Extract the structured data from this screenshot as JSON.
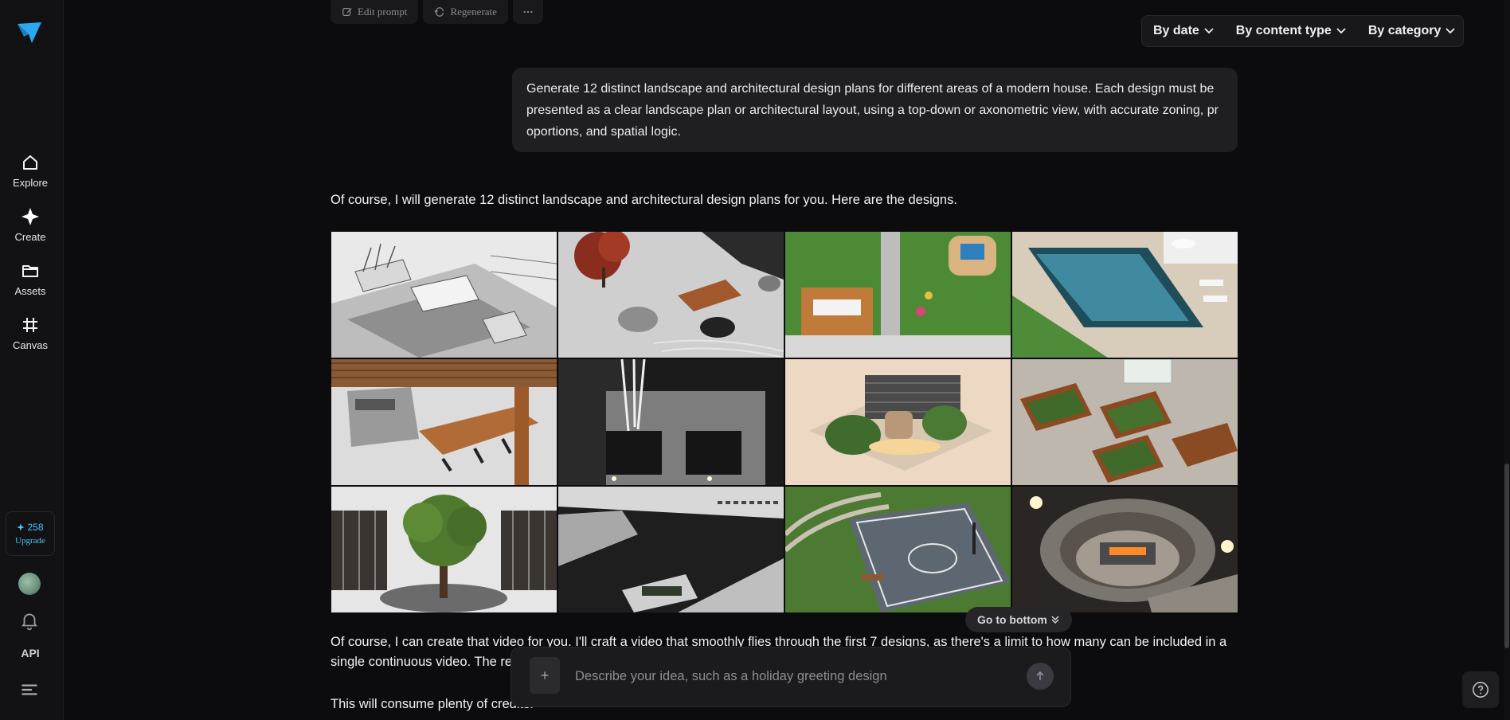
{
  "sidebar": {
    "items": [
      {
        "label": "Explore",
        "icon": "home-icon"
      },
      {
        "label": "Create",
        "icon": "sparkle-icon"
      },
      {
        "label": "Assets",
        "icon": "folder-icon"
      },
      {
        "label": "Canvas",
        "icon": "canvas-icon"
      }
    ],
    "credits": "258",
    "upgrade": "Upgrade",
    "api": "API"
  },
  "toolbar": {
    "edit_prompt": "Edit prompt",
    "regenerate": "Regenerate"
  },
  "filters": {
    "by_date": "By date",
    "by_content_type": "By content type",
    "by_category": "By category"
  },
  "conversation": {
    "user_prompt": "Generate 12 distinct landscape and architectural design plans for different areas of a modern house. Each design must be presented as a clear landscape plan or architectural layout, using a top-down or axonometric view, with accurate zoning, proportions, and spatial logic.",
    "assistant_reply_1": "Of course, I will generate 12 distinct landscape and architectural design plans for you. Here are the designs.",
    "assistant_reply_2_line1": "Of course, I can create that video for you. I'll craft a video that smoothly flies through the first 7 designs, as there's a limit to how many can be included in a",
    "assistant_reply_2_line2": "single continuous video. The res",
    "assistant_reply_3": "This will consume plenty of credits."
  },
  "images": [
    {
      "name": "image-rooftop-terrace"
    },
    {
      "name": "image-zen-garden"
    },
    {
      "name": "image-family-garden"
    },
    {
      "name": "image-infinity-pool"
    },
    {
      "name": "image-outdoor-kitchen"
    },
    {
      "name": "image-birch-courtyard"
    },
    {
      "name": "image-reading-nook"
    },
    {
      "name": "image-raised-beds"
    },
    {
      "name": "image-atrium-tree"
    },
    {
      "name": "image-driveway"
    },
    {
      "name": "image-sports-court"
    },
    {
      "name": "image-fire-pit"
    }
  ],
  "go_to_bottom": "Go to bottom",
  "composer": {
    "placeholder": "Describe your idea, such as a holiday greeting design"
  },
  "colors": {
    "accent": "#4fc3f7",
    "background": "#0c0c0e"
  }
}
